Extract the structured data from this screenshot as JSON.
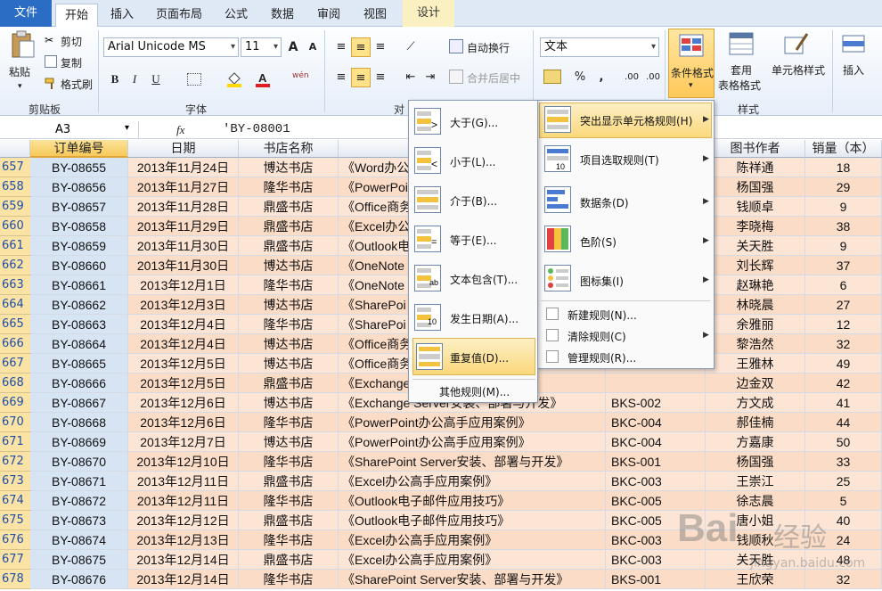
{
  "tabs": {
    "file": "文件",
    "home": "开始",
    "insert": "插入",
    "page_layout": "页面布局",
    "formulas": "公式",
    "data": "数据",
    "review": "审阅",
    "view": "视图",
    "design": "设计"
  },
  "ribbon": {
    "paste": "粘贴",
    "cut": "剪切",
    "copy": "复制",
    "format_painter": "格式刷",
    "clipboard_group": "剪贴板",
    "font_name": "Arial Unicode MS",
    "font_size": "11",
    "grow_font": "A",
    "shrink_font": "A",
    "bold": "B",
    "italic": "I",
    "underline": "U",
    "phonetic": "wén",
    "font_group": "字体",
    "wrap_text": "自动换行",
    "merge_center": "合并后居中",
    "align_group": "对",
    "number_format": "文本",
    "percent": "%",
    "comma": ",",
    "inc_dec": ".00",
    "dec_dec": ".00",
    "conditional_format": "条件格式",
    "table_format_1": "套用",
    "table_format_2": "表格格式",
    "cell_styles": "单元格样式",
    "styles_group": "样式",
    "insert": "插入"
  },
  "formula_bar": {
    "name_box": "A3",
    "fx": "fx",
    "formula": "'BY-08001"
  },
  "columns": {
    "a": "订单编号",
    "b": "日期",
    "c": "书店名称",
    "g": "图书作者",
    "h": "销量（本）"
  },
  "rows": [
    {
      "n": "657",
      "id": "BY-08655",
      "date": "2013年11月24日",
      "shop": "博达书店",
      "book": "《Word办公",
      "code": "",
      "author": "陈祥通",
      "qty": "18"
    },
    {
      "n": "658",
      "id": "BY-08656",
      "date": "2013年11月27日",
      "shop": "隆华书店",
      "book": "《PowerPoi",
      "code": "",
      "author": "杨国强",
      "qty": "29"
    },
    {
      "n": "659",
      "id": "BY-08657",
      "date": "2013年11月28日",
      "shop": "鼎盛书店",
      "book": "《Office商务",
      "code": "",
      "author": "钱顺卓",
      "qty": "9"
    },
    {
      "n": "660",
      "id": "BY-08658",
      "date": "2013年11月29日",
      "shop": "鼎盛书店",
      "book": "《Excel办公",
      "code": "",
      "author": "李晓梅",
      "qty": "38"
    },
    {
      "n": "661",
      "id": "BY-08659",
      "date": "2013年11月30日",
      "shop": "鼎盛书店",
      "book": "《Outlook电",
      "code": "",
      "author": "关天胜",
      "qty": "9"
    },
    {
      "n": "662",
      "id": "BY-08660",
      "date": "2013年11月30日",
      "shop": "博达书店",
      "book": "《OneNote",
      "code": "",
      "author": "刘长辉",
      "qty": "37"
    },
    {
      "n": "663",
      "id": "BY-08661",
      "date": "2013年12月1日",
      "shop": "隆华书店",
      "book": "《OneNote",
      "code": "",
      "author": "赵琳艳",
      "qty": "6"
    },
    {
      "n": "664",
      "id": "BY-08662",
      "date": "2013年12月3日",
      "shop": "博达书店",
      "book": "《SharePoi",
      "code": "",
      "author": "林晓晨",
      "qty": "27"
    },
    {
      "n": "665",
      "id": "BY-08663",
      "date": "2013年12月4日",
      "shop": "隆华书店",
      "book": "《SharePoi",
      "code": "",
      "author": "余雅丽",
      "qty": "12"
    },
    {
      "n": "666",
      "id": "BY-08664",
      "date": "2013年12月4日",
      "shop": "博达书店",
      "book": "《Office商务",
      "code": "",
      "author": "黎浩然",
      "qty": "32"
    },
    {
      "n": "667",
      "id": "BY-08665",
      "date": "2013年12月5日",
      "shop": "博达书店",
      "book": "《Office商务",
      "code": "",
      "author": "王雅林",
      "qty": "49"
    },
    {
      "n": "668",
      "id": "BY-08666",
      "date": "2013年12月5日",
      "shop": "鼎盛书店",
      "book": "《Exchange",
      "code": "",
      "author": "边金双",
      "qty": "42"
    },
    {
      "n": "669",
      "id": "BY-08667",
      "date": "2013年12月6日",
      "shop": "博达书店",
      "book": "《Exchange Server安装、部署与开发》",
      "code": "BKS-002",
      "author": "方文成",
      "qty": "41"
    },
    {
      "n": "670",
      "id": "BY-08668",
      "date": "2013年12月6日",
      "shop": "隆华书店",
      "book": "《PowerPoint办公高手应用案例》",
      "code": "BKC-004",
      "author": "郝佳楠",
      "qty": "44"
    },
    {
      "n": "671",
      "id": "BY-08669",
      "date": "2013年12月7日",
      "shop": "博达书店",
      "book": "《PowerPoint办公高手应用案例》",
      "code": "BKC-004",
      "author": "方嘉康",
      "qty": "50"
    },
    {
      "n": "672",
      "id": "BY-08670",
      "date": "2013年12月10日",
      "shop": "隆华书店",
      "book": "《SharePoint Server安装、部署与开发》",
      "code": "BKS-001",
      "author": "杨国强",
      "qty": "33"
    },
    {
      "n": "673",
      "id": "BY-08671",
      "date": "2013年12月11日",
      "shop": "鼎盛书店",
      "book": "《Excel办公高手应用案例》",
      "code": "BKC-003",
      "author": "王崇江",
      "qty": "25"
    },
    {
      "n": "674",
      "id": "BY-08672",
      "date": "2013年12月11日",
      "shop": "隆华书店",
      "book": "《Outlook电子邮件应用技巧》",
      "code": "BKC-005",
      "author": "徐志晨",
      "qty": "5"
    },
    {
      "n": "675",
      "id": "BY-08673",
      "date": "2013年12月12日",
      "shop": "鼎盛书店",
      "book": "《Outlook电子邮件应用技巧》",
      "code": "BKC-005",
      "author": "唐小姐",
      "qty": "40"
    },
    {
      "n": "676",
      "id": "BY-08674",
      "date": "2013年12月13日",
      "shop": "隆华书店",
      "book": "《Excel办公高手应用案例》",
      "code": "BKC-003",
      "author": "钱顺秋",
      "qty": "24"
    },
    {
      "n": "677",
      "id": "BY-08675",
      "date": "2013年12月14日",
      "shop": "鼎盛书店",
      "book": "《Excel办公高手应用案例》",
      "code": "BKC-003",
      "author": "关天胜",
      "qty": "48"
    },
    {
      "n": "678",
      "id": "BY-08676",
      "date": "2013年12月14日",
      "shop": "隆华书店",
      "book": "《SharePoint Server安装、部署与开发》",
      "code": "BKS-001",
      "author": "王欣荣",
      "qty": "32"
    }
  ],
  "menu_main": {
    "highlight": "突出显示单元格规则(H)",
    "top_bottom": "项目选取规则(T)",
    "data_bars": "数据条(D)",
    "color_scales": "色阶(S)",
    "icon_sets": "图标集(I)",
    "new_rule": "新建规则(N)...",
    "clear_rules": "清除规则(C)",
    "manage_rules": "管理规则(R)..."
  },
  "menu_sub": {
    "greater": "大于(G)...",
    "less": "小于(L)...",
    "between": "介于(B)...",
    "equal": "等于(E)...",
    "text_contains": "文本包含(T)...",
    "date_occurring": "发生日期(A)...",
    "duplicate": "重复值(D)...",
    "more_rules": "其他规则(M)..."
  },
  "sub_icon_labels": {
    "equal": "=",
    "text": "ab",
    "date": "10"
  },
  "watermark": {
    "brand": "Bai",
    "brand2": "经验",
    "url": "jingyan.baidu.com"
  },
  "colors": {
    "accent": "#2b6cc4",
    "menu_highlight": "#fbd87c",
    "row_header": "#fbe3a5",
    "id_fill": "#d6e4f4",
    "peach": "#fde5d6"
  }
}
